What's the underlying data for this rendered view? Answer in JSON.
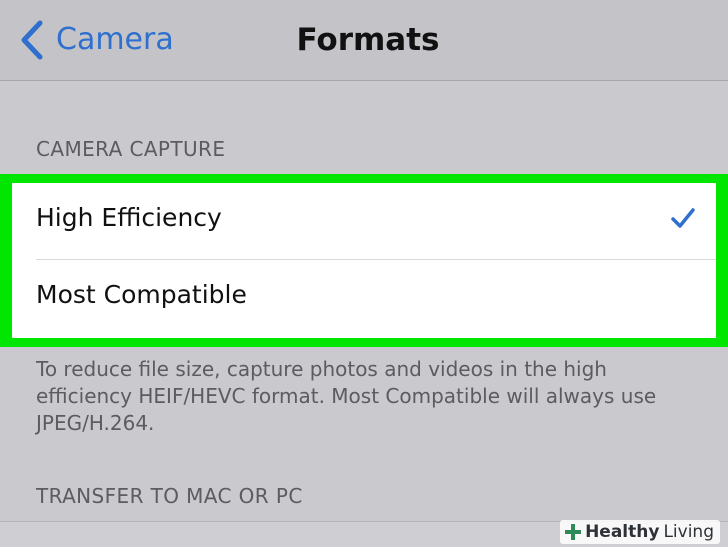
{
  "navbar": {
    "back_label": "Camera",
    "title": "Formats"
  },
  "camera_capture": {
    "header": "CAMERA CAPTURE",
    "options": [
      {
        "label": "High Efficiency",
        "selected": true
      },
      {
        "label": "Most Compatible",
        "selected": false
      }
    ],
    "footer": "To reduce file size, capture photos and videos in the high efficiency HEIF/HEVC format. Most Compatible will always use JPEG/H.264."
  },
  "transfer": {
    "header": "TRANSFER TO MAC OR PC"
  },
  "watermark": {
    "strong": "Healthy",
    "light": "Living"
  },
  "colors": {
    "accent": "#2f6fce",
    "highlight": "#00e600",
    "background": "#c9c9ce"
  },
  "icons": {
    "back": "chevron-left-icon",
    "selected": "checkmark-icon",
    "watermark": "plus-leaf-icon"
  }
}
